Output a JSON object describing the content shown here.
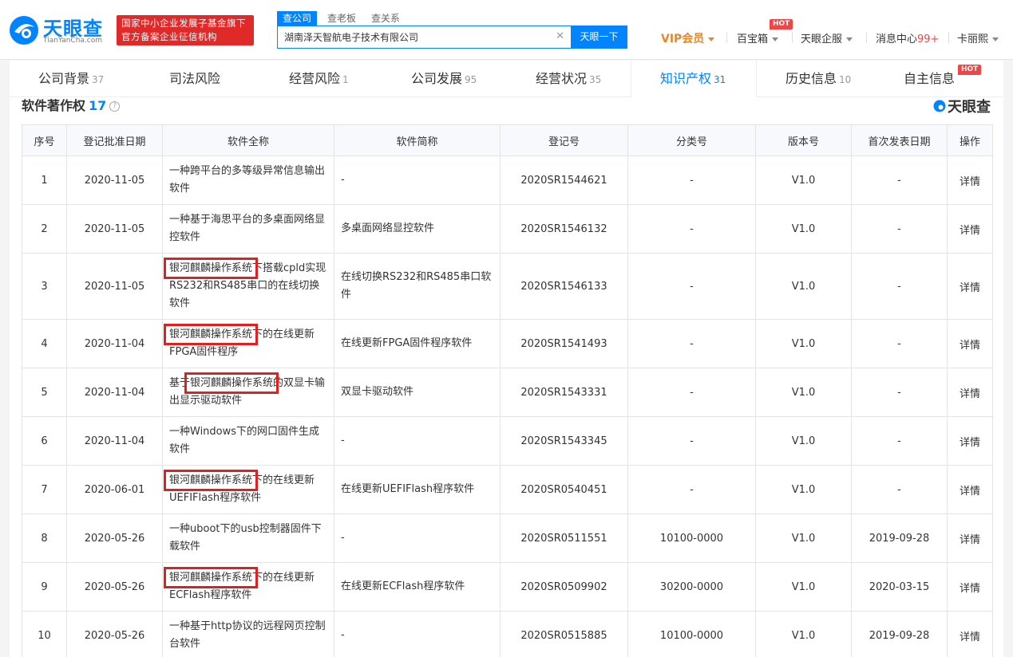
{
  "header": {
    "logo_cn": "天眼查",
    "logo_en": "TianYanCha.com",
    "badge_line1": "国家中小企业发展子基金旗下",
    "badge_line2": "官方备案企业征信机构",
    "search_tabs": [
      "查公司",
      "查老板",
      "查关系"
    ],
    "search_value": "湖南泽天智航电子技术有限公司",
    "search_button": "天眼一下",
    "vip": "VIP会员",
    "nav": {
      "baobaoxiang": "百宝箱",
      "qiye": "天眼企服",
      "msg_label": "消息中心",
      "msg_count": "99+",
      "user": "卡丽熙"
    },
    "hot": "HOT"
  },
  "tabs": [
    {
      "label": "公司背景",
      "count": "37"
    },
    {
      "label": "司法风险",
      "count": ""
    },
    {
      "label": "经营风险",
      "count": "1"
    },
    {
      "label": "公司发展",
      "count": "95"
    },
    {
      "label": "经营状况",
      "count": "35"
    },
    {
      "label": "知识产权",
      "count": "31"
    },
    {
      "label": "历史信息",
      "count": "10"
    },
    {
      "label": "自主信息",
      "count": ""
    }
  ],
  "section": {
    "title": "软件著作权",
    "count": "17",
    "help": "?",
    "brand": "天眼查"
  },
  "table": {
    "headers": [
      "序号",
      "登记批准日期",
      "软件全称",
      "软件简称",
      "登记号",
      "分类号",
      "版本号",
      "首次发表日期",
      "操作"
    ],
    "rows": [
      [
        "1",
        "2020-11-05",
        "一种跨平台的多等级异常信息输出软件",
        "-",
        "2020SR1544621",
        "-",
        "V1.0",
        "-",
        "详情"
      ],
      [
        "2",
        "2020-11-05",
        "一种基于海思平台的多桌面网络显控软件",
        "多桌面网络显控软件",
        "2020SR1546132",
        "-",
        "V1.0",
        "-",
        "详情"
      ],
      [
        "3",
        "2020-11-05",
        "银河麒麟操作系统下搭载cpld实现RS232和RS485串口的在线切换软件",
        "在线切换RS232和RS485串口软件",
        "2020SR1546133",
        "-",
        "V1.0",
        "-",
        "详情"
      ],
      [
        "4",
        "2020-11-04",
        "银河麒麟操作系统下的在线更新FPGA固件程序",
        "在线更新FPGA固件程序软件",
        "2020SR1541493",
        "-",
        "V1.0",
        "-",
        "详情"
      ],
      [
        "5",
        "2020-11-04",
        "基于银河麒麟操作系统的双显卡输出显示驱动软件",
        "双显卡驱动软件",
        "2020SR1543331",
        "-",
        "V1.0",
        "-",
        "详情"
      ],
      [
        "6",
        "2020-11-04",
        "一种Windows下的网口固件生成软件",
        "-",
        "2020SR1543345",
        "-",
        "V1.0",
        "-",
        "详情"
      ],
      [
        "7",
        "2020-06-01",
        "银河麒麟操作系统下的在线更新UEFIFlash程序软件",
        "在线更新UEFIFlash程序软件",
        "2020SR0540451",
        "-",
        "V1.0",
        "-",
        "详情"
      ],
      [
        "8",
        "2020-05-26",
        "一种uboot下的usb控制器固件下载软件",
        "-",
        "2020SR0511551",
        "10100-0000",
        "V1.0",
        "2019-09-28",
        "详情"
      ],
      [
        "9",
        "2020-05-26",
        "银河麒麟操作系统下的在线更新ECFlash程序软件",
        "在线更新ECFlash程序软件",
        "2020SR0509902",
        "30200-0000",
        "V1.0",
        "2020-03-15",
        "详情"
      ],
      [
        "10",
        "2020-05-26",
        "一种基于http协议的远程网页控制台软件",
        "-",
        "2020SR0515885",
        "10100-0000",
        "V1.0",
        "2019-09-28",
        "详情"
      ]
    ]
  },
  "colors": {
    "brand_blue": "#0084ff",
    "highlight_red": "#e02020",
    "badge_red": "#e02a2a",
    "vip_orange": "#e8862c"
  }
}
